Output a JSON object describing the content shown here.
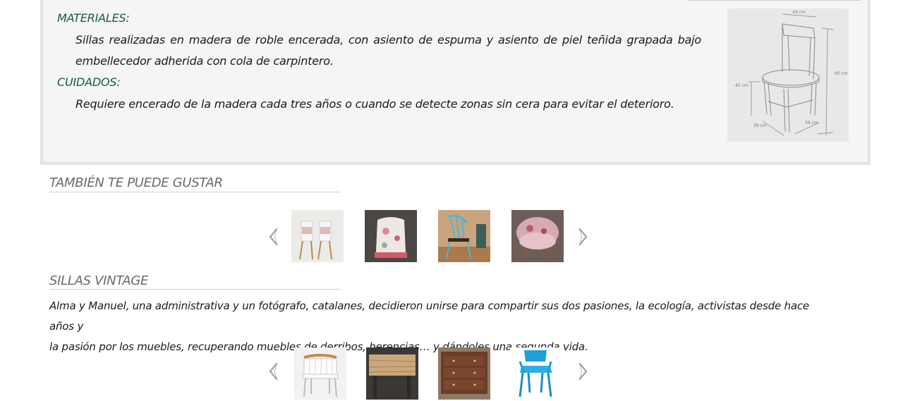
{
  "product_info": {
    "materiales_heading": "MATERIALES:",
    "materiales_text": "Sillas realizadas en madera de roble encerada, con asiento de espuma y asiento de piel teñida grapada bajo embellecedor adherida con cola de carpintero.",
    "cuidados_heading": "CUIDADOS:",
    "cuidados_text": "Requiere encerado de la madera cada tres años o cuando se detecte zonas sin cera para evitar el deterioro.",
    "diagram": {
      "width_label": "44 cm",
      "height_label": "90 cm",
      "seat_height_label": "42 cm",
      "depth_label": "39 cm",
      "seat_depth_label": "39 cm"
    }
  },
  "related": {
    "title": "TAMBIÉN TE PUEDE GUSTAR",
    "products": [
      {
        "icon": "white-wooden-chairs-thumbnail"
      },
      {
        "icon": "floral-armchair-thumbnail"
      },
      {
        "icon": "blue-windsor-chair-thumbnail"
      },
      {
        "icon": "pink-floral-tub-chair-thumbnail"
      }
    ],
    "prev_icon": "chevron-left-icon",
    "next_icon": "chevron-right-icon"
  },
  "brand": {
    "title": "SILLAS VINTAGE",
    "description_line1": "Alma y Manuel, una administrativa y un fotógrafo, catalanes, decidieron unirse para compartir sus dos pasiones, la ecología, activistas desde hace años y",
    "description_line2": "la pasión por los muebles, recuperando muebles de derribos, herencias… y dándoles una segunda vida.",
    "products": [
      {
        "icon": "white-chair-thumbnail"
      },
      {
        "icon": "wooden-table-thumbnail"
      },
      {
        "icon": "wooden-dresser-thumbnail"
      },
      {
        "icon": "blue-metal-chair-thumbnail"
      }
    ],
    "prev_icon": "chevron-left-icon",
    "next_icon": "chevron-right-icon"
  },
  "colors": {
    "heading_teal": "#17574f",
    "panel_bg": "#f5f5f3",
    "section_title_gray": "#6a6a6a"
  }
}
